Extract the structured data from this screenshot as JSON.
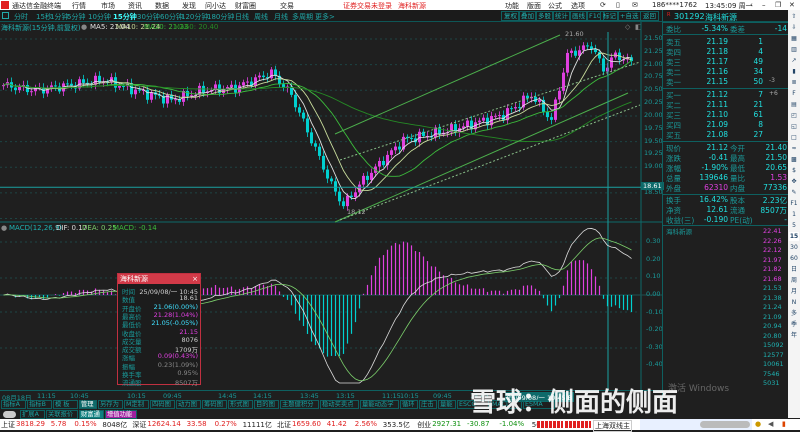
{
  "titlebar": {
    "app_name": "通达信金融终端",
    "menu": [
      "行情",
      "市场",
      "资讯",
      "数据",
      "发现",
      "问小达",
      "财富圈",
      "交易"
    ],
    "login_notice": "证券交易未登录",
    "stock_name": "海科新源",
    "right_menu": [
      "功能",
      "版面",
      "公式",
      "选项"
    ],
    "account": "186****1762",
    "clock": "13:45:09 周一"
  },
  "toolbar": {
    "periods": [
      "分时",
      "15秒",
      "1分钟",
      "5分钟",
      "10分钟",
      "15分钟",
      "30分钟",
      "60分钟",
      "120分钟",
      "180分钟",
      "日线",
      "周线",
      "月线",
      "多周期",
      "更多>"
    ],
    "active_period": "15分钟",
    "buttons": [
      "复权",
      "叠加",
      "多股",
      "统计",
      "画线",
      "F10",
      "标记",
      "+自选",
      "返回"
    ]
  },
  "chart_header": {
    "title": "海科新源(15分钟,前复权)",
    "ma5": "MA5: 21.04",
    "ma10": "MA10: 21.24",
    "ma20": "MA20: 21.23",
    "ma60": "MA60: 20.40"
  },
  "colors": {
    "up": "#e040e0",
    "down": "#00d0d0",
    "ma5": "#e0e0e0",
    "ma10": "#c8dc9c",
    "ma20": "#3cbc3c",
    "ma60": "#258a25",
    "accent": "#d23a48"
  },
  "kline": {
    "count": 158,
    "keypoints": [
      [
        0,
        20.6
      ],
      [
        8,
        20.5
      ],
      [
        25,
        20.7
      ],
      [
        35,
        20.45
      ],
      [
        42,
        20.31
      ],
      [
        50,
        20.5
      ],
      [
        58,
        20.55
      ],
      [
        67,
        20.84
      ],
      [
        72,
        20.41
      ],
      [
        77,
        19.53
      ],
      [
        82,
        18.65
      ],
      [
        85,
        18.26
      ],
      [
        90,
        18.75
      ],
      [
        100,
        19.53
      ],
      [
        112,
        19.73
      ],
      [
        125,
        20.02
      ],
      [
        132,
        20.41
      ],
      [
        137,
        19.92
      ],
      [
        141,
        21.19
      ],
      [
        147,
        21.38
      ],
      [
        150,
        20.9
      ],
      [
        153,
        21.19
      ],
      [
        157,
        21.05
      ]
    ],
    "price_labels": [
      "21.50",
      "21.25",
      "21.00",
      "20.75",
      "20.50",
      "20.25",
      "20.00",
      "19.75",
      "19.50",
      "19.25",
      "19.00",
      "18.50"
    ],
    "high_label": "21.60",
    "low_label": "18.12",
    "cursor_price": "18.61"
  },
  "macd": {
    "title": "MACD(12,26,9)",
    "dif": "DIF: 0.17",
    "dea": "DEA: 0.25",
    "macd": "MACD: -0.14",
    "axis": [
      "0.30",
      "0.20",
      "0.10",
      "0.00",
      "-0.10",
      "-0.20",
      "-0.30",
      "-0.40"
    ]
  },
  "time_axis": [
    "08月18日",
    "11:15",
    "10:45",
    "10:15",
    "09:45",
    "14:45",
    "14:15",
    "13:45",
    "13:15",
    "11:15",
    "10:15",
    "09:45",
    "14:45"
  ],
  "cursor_time": "25/09/08/一 10:45 B",
  "popup": {
    "title": "海科新源",
    "rows": [
      [
        "时间",
        "25/09/08/一 10:45"
      ],
      [
        "数值",
        "18.61"
      ],
      [
        "开盘价",
        "21.06(0.00%)"
      ],
      [
        "最高价",
        "21.28(1.04%)"
      ],
      [
        "最低价",
        "21.05(-0.05%)"
      ],
      [
        "收盘价",
        "21.15"
      ],
      [
        "成交量",
        "8076"
      ],
      [
        "成交额",
        "1709万"
      ],
      [
        "涨幅",
        "0.09(0.43%)"
      ],
      [
        "振幅",
        "0.23(1.09%)"
      ],
      [
        "换手率",
        "0.95%"
      ],
      [
        "流通股",
        "8507万"
      ]
    ]
  },
  "quote": {
    "code": "301292",
    "name": "海科新源",
    "weibi_label": "委比",
    "weibi": "-5.34%",
    "weicha_label": "委差",
    "weicha": "-14",
    "asks": [
      [
        "卖五",
        "21.19",
        "1",
        ""
      ],
      [
        "卖四",
        "21.18",
        "4",
        ""
      ],
      [
        "卖三",
        "21.17",
        "49",
        ""
      ],
      [
        "卖二",
        "21.16",
        "34",
        ""
      ],
      [
        "卖一",
        "21.15",
        "50",
        "-3"
      ]
    ],
    "bids": [
      [
        "买一",
        "21.12",
        "7",
        "+6"
      ],
      [
        "买二",
        "21.11",
        "21",
        ""
      ],
      [
        "买三",
        "21.10",
        "61",
        ""
      ],
      [
        "买四",
        "21.09",
        "8",
        ""
      ],
      [
        "买五",
        "21.08",
        "27",
        ""
      ]
    ],
    "stats": [
      [
        "现价",
        "21.12",
        "今开",
        "21.40"
      ],
      [
        "涨跌",
        "-0.41",
        "最高",
        "21.50"
      ],
      [
        "涨幅",
        "-1.90%",
        "最低",
        "20.65"
      ],
      [
        "总量",
        "139646",
        "量比",
        "1.53"
      ],
      [
        "外盘",
        "62310",
        "内盘",
        "77336"
      ],
      [
        "换手",
        "16.42%",
        "股本",
        "2.23亿"
      ],
      [
        "净资",
        "12.61",
        "流通",
        "8507万"
      ],
      [
        "收益(三)",
        "-0.190",
        "PE(动)",
        "-"
      ]
    ]
  },
  "mini_chart": {
    "title": "海科新源",
    "price_axis": [
      "22.41",
      "22.26",
      "22.12",
      "21.97",
      "21.82",
      "21.68",
      "21.53",
      "21.38",
      "21.24",
      "21.09",
      "20.94",
      "20.80"
    ],
    "volume_axis": [
      "15092",
      "12577",
      "10061",
      "7546",
      "5031"
    ],
    "prices": [
      21.4,
      20.9,
      20.85,
      21.0,
      20.95,
      21.05,
      21.0,
      21.1,
      21.05,
      21.15,
      21.1,
      21.25,
      21.2,
      21.3,
      21.25,
      21.35,
      21.3,
      21.28,
      21.2,
      21.15,
      21.25,
      21.18,
      21.12,
      21.1,
      21.02,
      21.05,
      20.98,
      21.0,
      21.08,
      21.12
    ],
    "avg": [
      21.4,
      21.0,
      20.98,
      20.98,
      20.99,
      21.0,
      21.01,
      21.02,
      21.03,
      21.04,
      21.05,
      21.06,
      21.07,
      21.08,
      21.09,
      21.1,
      21.1,
      21.11,
      21.11,
      21.11,
      21.12,
      21.12,
      21.12,
      21.12,
      21.11,
      21.11,
      21.11,
      21.1,
      21.1,
      21.1
    ]
  },
  "side_icons": [
    "F1",
    "1",
    "5",
    "15",
    "30",
    "60",
    "日",
    "周",
    "月",
    "N",
    "多",
    "季",
    "年"
  ],
  "bottom_buttons": [
    "指标A",
    "指标B",
    "模 板",
    "管理",
    "另存为",
    "M定制",
    "四码图",
    "动力图",
    "筹码图",
    "形式图",
    "目的图",
    "主题健积分",
    "稳动买卖点",
    "量能动态学",
    "循环",
    "庄击",
    "量能",
    "ESCO",
    "MACD",
    "ESMA"
  ],
  "bottom_buttons2": [
    "扩展A",
    "关联报价",
    "财富通",
    "增值功能"
  ],
  "status": {
    "indices": [
      {
        "name": "上证",
        "value": "3818.29",
        "chg": "5.78",
        "pct": "0.15%",
        "amt": "8048亿"
      },
      {
        "name": "深证",
        "value": "12624.14",
        "chg": "33.58",
        "pct": "0.27%",
        "amt": "11111亿"
      },
      {
        "name": "北证",
        "value": "1659.60",
        "chg": "41.42",
        "pct": "2.56%",
        "amt": "353.5亿"
      },
      {
        "name": "创业",
        "value": "2927.31",
        "chg": "-30.87",
        "pct": "-1.04%",
        "amt": "5634亿"
      }
    ],
    "ticker": "上海双线主"
  },
  "watermark": "雪球：侧面的侧面",
  "windows_notice": "激活 Windows"
}
